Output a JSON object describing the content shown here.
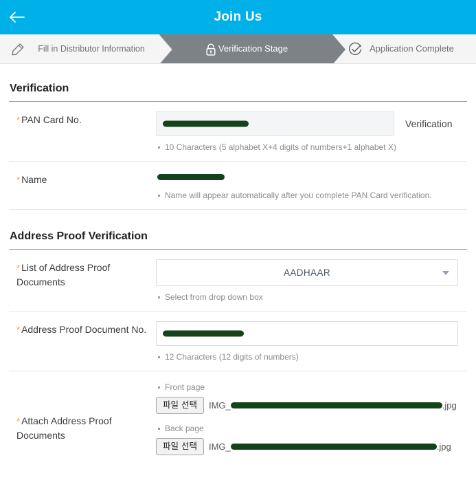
{
  "appbar": {
    "title": "Join Us",
    "back_icon": "arrow-left-icon",
    "background": "#00b0e8"
  },
  "stepper": {
    "steps": [
      {
        "label": "Fill in Distributor Information",
        "icon": "pencil-icon",
        "state": "done"
      },
      {
        "label": "Verification Stage",
        "icon": "lock-icon",
        "state": "active"
      },
      {
        "label": "Application Complete",
        "icon": "check-circle-icon",
        "state": "upcoming"
      }
    ],
    "active_background": "#7d8287"
  },
  "verification_section": {
    "title": "Verification",
    "pan": {
      "label": "PAN Card No.",
      "required_mark": "*",
      "value": "",
      "redacted": true,
      "redaction_width": 125,
      "button_label": "Verification",
      "hint": "10 Characters (5 alphabet X+4 digits of numbers+1 alphabet X)",
      "disabled": true
    },
    "name": {
      "label": "Name",
      "required_mark": "*",
      "value": "",
      "redacted": true,
      "redaction_width": 98,
      "hint": "Name will appear automatically after you complete PAN Card verification."
    }
  },
  "address_proof_section": {
    "title": "Address Proof Verification",
    "doc_list": {
      "label": "List of Address Proof Documents",
      "required_mark": "*",
      "selected": "AADHAAR",
      "caret_icon": "chevron-down-icon",
      "hint": "Select from drop down box"
    },
    "doc_no": {
      "label": "Address Proof Document No.",
      "required_mark": "*",
      "value": "",
      "redacted": true,
      "redaction_width": 118,
      "hint": "12 Characters (12 digits of numbers)"
    },
    "attachments": {
      "label": "Attach Address Proof Documents",
      "required_mark": "*",
      "files": [
        {
          "page_hint": "Front page",
          "button_label": "파일 선택",
          "name_prefix": "IMG_",
          "redaction_width": 308,
          "name_suffix": ".jpg"
        },
        {
          "page_hint": "Back page",
          "button_label": "파일 선택",
          "name_prefix": "IMG_",
          "redaction_width": 300,
          "name_suffix": ".jpg"
        }
      ]
    }
  },
  "colors": {
    "accent": "#00b0e8",
    "required": "#f5a21e",
    "redaction": "#14431b",
    "step_active": "#7d8287"
  }
}
